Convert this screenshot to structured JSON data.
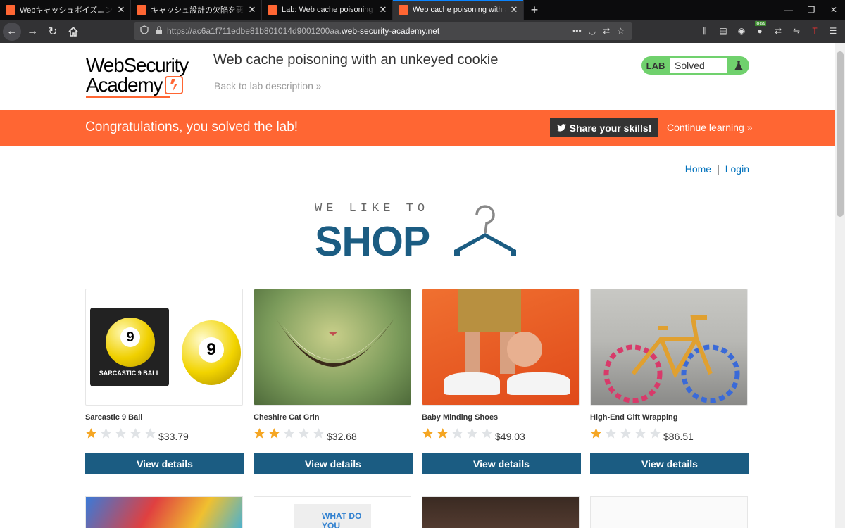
{
  "browser": {
    "tabs": [
      {
        "title": "Webキャッシュポイズニング| Webセ",
        "active": false
      },
      {
        "title": "キャッシュ設計の欠陥を悪用する| W",
        "active": false
      },
      {
        "title": "Lab: Web cache poisoning with",
        "active": false
      },
      {
        "title": "Web cache poisoning with an un",
        "active": true
      }
    ],
    "url_prefix": "https://ac6a1f711edbe81b801014d9001200aa.",
    "url_domain": "web-security-academy.net",
    "ext_badge": "local",
    "accent": "#0a84ff"
  },
  "header": {
    "logo_line1": "WebSecurity",
    "logo_line2": "Academy",
    "lab_title": "Web cache poisoning with an unkeyed cookie",
    "back_link": "Back to lab description",
    "lab_label": "LAB",
    "lab_status": "Solved",
    "status_color": "#70d16d"
  },
  "banner": {
    "message": "Congratulations, you solved the lab!",
    "share_label": "Share your skills!",
    "continue_label": "Continue learning",
    "color": "#ff6633"
  },
  "nav": {
    "home": "Home",
    "sep": "|",
    "login": "Login"
  },
  "hero": {
    "line1": "WE LIKE TO",
    "line2": "SHOP"
  },
  "products": [
    {
      "name": "Sarcastic 9 Ball",
      "rating": 1,
      "price": "$33.79",
      "button": "View details",
      "image_text": "SARCASTIC 9 BALL"
    },
    {
      "name": "Cheshire Cat Grin",
      "rating": 2,
      "price": "$32.68",
      "button": "View details"
    },
    {
      "name": "Baby Minding Shoes",
      "rating": 2,
      "price": "$49.03",
      "button": "View details"
    },
    {
      "name": "High-End Gift Wrapping",
      "rating": 1,
      "price": "$86.51",
      "button": "View details"
    }
  ],
  "row2_text": "WHAT DO YOU"
}
